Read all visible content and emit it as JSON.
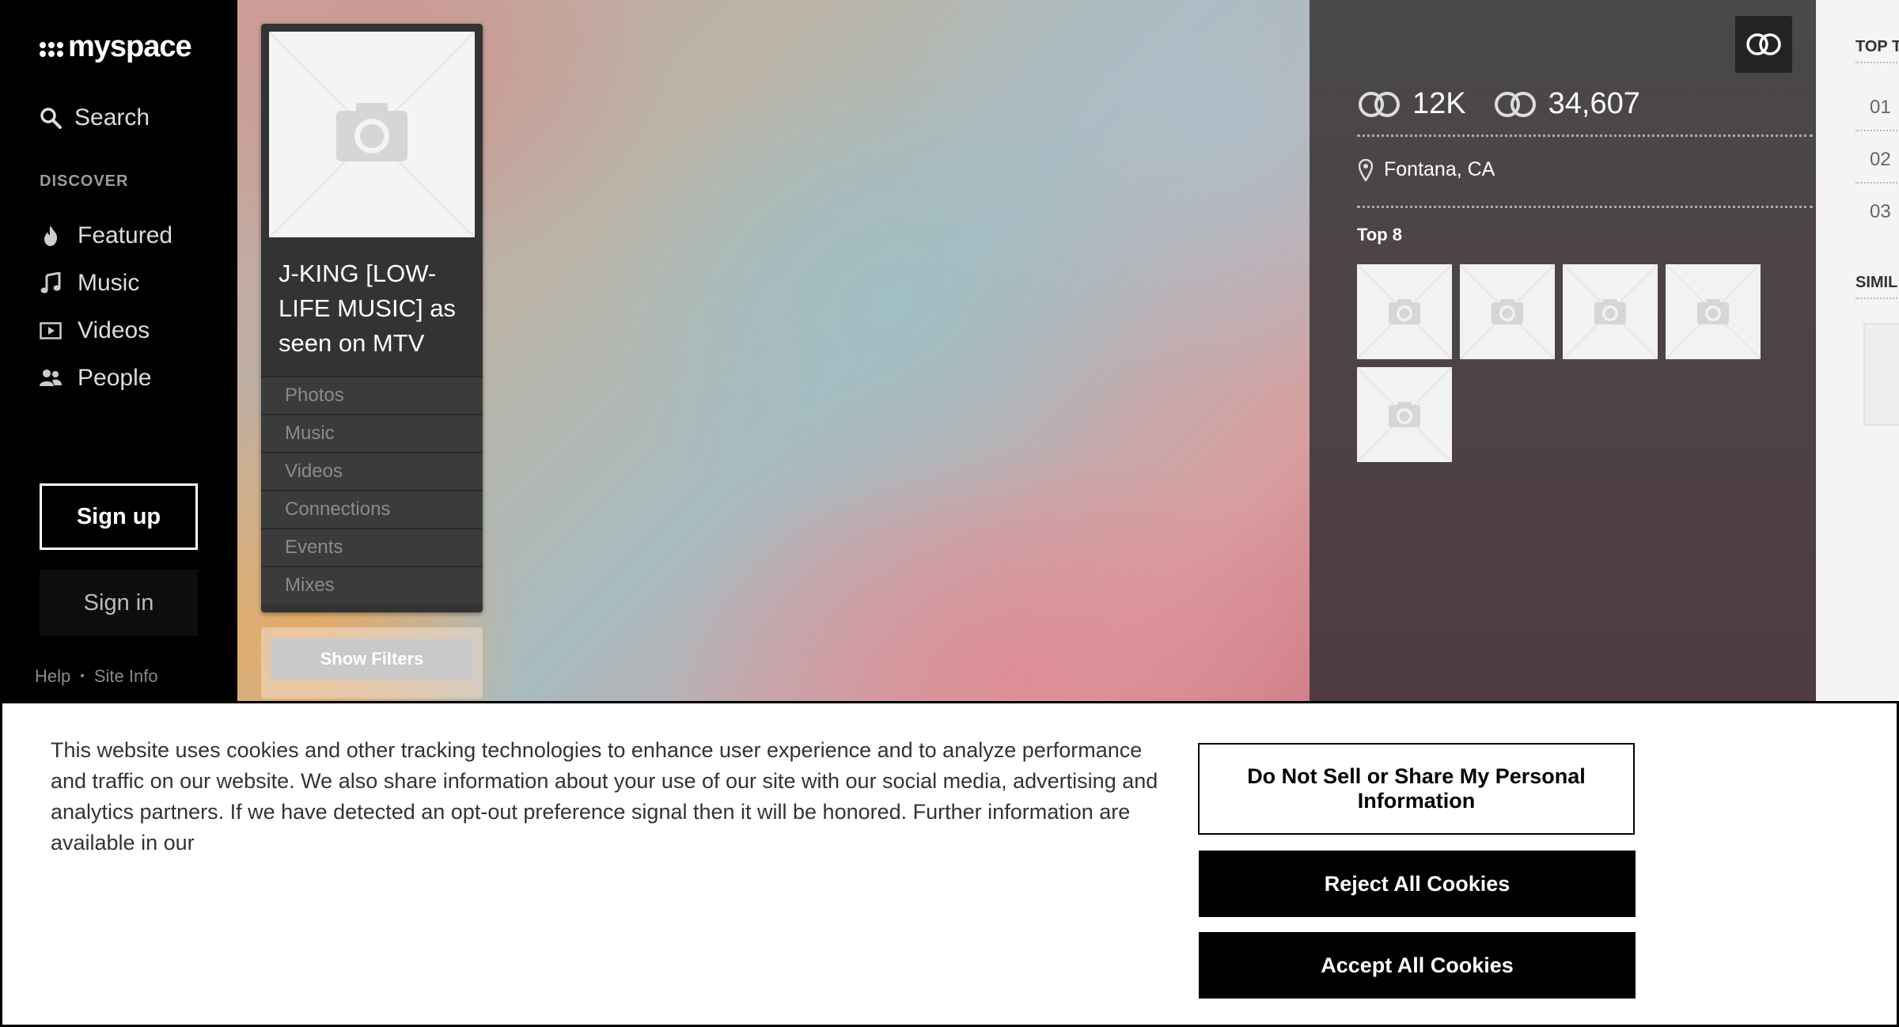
{
  "brand": {
    "logo_text": "myspace"
  },
  "sidebar": {
    "search_label": "Search",
    "discover_heading": "DISCOVER",
    "items": [
      {
        "label": "Featured",
        "icon": "flame-icon"
      },
      {
        "label": "Music",
        "icon": "music-note-icon"
      },
      {
        "label": "Videos",
        "icon": "video-play-icon"
      },
      {
        "label": "People",
        "icon": "people-icon"
      }
    ],
    "signup_label": "Sign up",
    "signin_label": "Sign in",
    "footer": {
      "help": "Help",
      "separator": "•",
      "site_info": "Site Info"
    }
  },
  "profile": {
    "name": "J-KING [LOW-LIFE MUSIC] as seen on MTV",
    "menu": [
      "Photos",
      "Music",
      "Videos",
      "Connections",
      "Events",
      "Mixes"
    ],
    "show_filters_label": "Show Filters"
  },
  "stats_panel": {
    "connections_in": "12K",
    "connections_out": "34,607",
    "location": "Fontana, CA",
    "top8_label": "Top 8",
    "top8_count": 5
  },
  "right_strip": {
    "top_tracks_heading": "TOP T",
    "track_numbers": [
      "01",
      "02",
      "03"
    ],
    "similar_heading": "SIMIL"
  },
  "cookie_banner": {
    "text": "This website uses cookies and other tracking technologies to enhance user experience and to analyze performance and traffic on our website. We also share information about your use of our site with our social media, advertising and analytics partners. If we have detected an opt-out preference signal then it will be honored. Further information are available in our",
    "do_not_sell_label": "Do Not Sell or Share My Personal Information",
    "reject_label": "Reject All Cookies",
    "accept_label": "Accept All Cookies"
  },
  "colors": {
    "sidebar_bg": "#000000",
    "panel_bg": "#4a4848",
    "card_bg": "#333333",
    "banner_button_bg": "#000000"
  }
}
